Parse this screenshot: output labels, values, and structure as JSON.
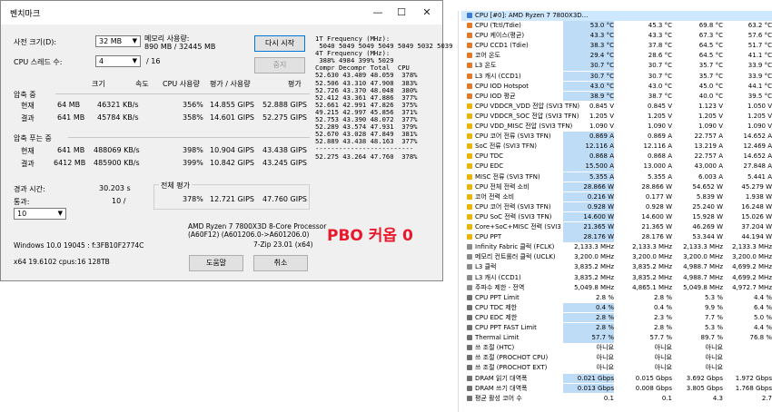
{
  "bench": {
    "title": "벤치마크",
    "dict_size_label": "사전 크기(D):",
    "dict_size_value": "32 MB",
    "threads_label": "CPU 스레드 수:",
    "threads_value": "4",
    "threads_max": "/ 16",
    "mem_usage_label": "메모리 사용량:",
    "mem_usage_value": "890 MB / 32445 MB",
    "restart_button": "다시 시작",
    "stop_button": "중지",
    "freq_text": "1T Frequency (MHz):\n 5040 5049 5049 5049 5049 5032 5039\n4T Frequency (MHz):\n 388% 4984 399% 5029\nCompr Decompr Total  CPU\n52.630 43.489 48.059  378%\n52.506 43.310 47.908  383%\n52.726 43.370 48.048  380%\n52.412 43.361 47.886  377%\n52.661 42.991 47.826  375%\n49.215 42.997 45.856  371%\n52.753 43.390 48.072  377%\n52.289 43.574 47.931  379%\n52.670 43.028 47.849  381%\n52.889 43.438 48.163  377%\n-------------------------\n52.275 43.264 47.760  378%",
    "col_headers": [
      "크기",
      "속도",
      "CPU 사용량",
      "평가 / 사용량",
      "평가"
    ],
    "compress_label": "압축 중",
    "decompress_label": "압축 푸는 중",
    "compress_rows": [
      {
        "label": "현재",
        "size": "64 MB",
        "speed": "46321 KB/s",
        "cpu": "356%",
        "per": "14.855 GIPS",
        "rating": "52.888 GIPS"
      },
      {
        "label": "결과",
        "size": "641 MB",
        "speed": "45784 KB/s",
        "cpu": "358%",
        "per": "14.601 GIPS",
        "rating": "52.275 GIPS"
      }
    ],
    "decompress_rows": [
      {
        "label": "현재",
        "size": "641 MB",
        "speed": "488069 KB/s",
        "cpu": "398%",
        "per": "10.904 GIPS",
        "rating": "43.438 GIPS"
      },
      {
        "label": "결과",
        "size": "6412 MB",
        "speed": "485900 KB/s",
        "cpu": "399%",
        "per": "10.842 GIPS",
        "rating": "43.245 GIPS"
      }
    ],
    "elapsed_label": "경과 시간:",
    "elapsed_value": "30.203 s",
    "passes_label": "통과:",
    "passes_value": "10 /",
    "passes_select": "10",
    "total_label": "전체 평가",
    "total_cpu": "378%",
    "total_per": "12.721 GIPS",
    "total_rating": "47.760 GIPS",
    "cpu_name": "AMD Ryzen 7 7800X3D 8-Core Processor",
    "cpu_id": "(A60F12) (A601206.0->A601206.0)",
    "zip_version": "7-Zip 23.01 (x64)",
    "os_info": "Windows 10.0 19045 : f:3FB10F2774C",
    "sys_info": "x64 19.6102 cpus:16 128TB",
    "help_button": "도움말",
    "cancel_button": "취소",
    "annotation": "PBO 커옵 0"
  },
  "sensor": {
    "header_label": "CPU [#0]: AMD Ryzen 7 7800X3D...",
    "rows": [
      {
        "name": "CPU (Tctl/Tdie)",
        "icon": "thermometer",
        "c": "53.0 °C",
        "min": "45.3 °C",
        "max": "69.8 °C",
        "avg": "63.2 °C",
        "hi": 0
      },
      {
        "name": "CPU 케이스(평균)",
        "icon": "thermometer",
        "c": "43.3 °C",
        "min": "43.3 °C",
        "max": "67.3 °C",
        "avg": "57.6 °C",
        "hi": 0
      },
      {
        "name": "CPU CCD1 (Tdie)",
        "icon": "thermometer",
        "c": "38.3 °C",
        "min": "37.8 °C",
        "max": "64.5 °C",
        "avg": "51.7 °C",
        "hi": 0
      },
      {
        "name": "코어 온도",
        "icon": "thermometer",
        "c": "29.4 °C",
        "min": "28.6 °C",
        "max": "64.5 °C",
        "avg": "41.1 °C",
        "hi": 0
      },
      {
        "name": "L3 온도",
        "icon": "thermometer",
        "c": "30.7 °C",
        "min": "30.7 °C",
        "max": "35.7 °C",
        "avg": "33.9 °C",
        "hi": 0
      },
      {
        "name": "L3 캐시 (CCD1)",
        "icon": "thermometer",
        "c": "30.7 °C",
        "min": "30.7 °C",
        "max": "35.7 °C",
        "avg": "33.9 °C",
        "hi": 0
      },
      {
        "name": "CPU IOD Hotspot",
        "icon": "thermometer",
        "c": "43.0 °C",
        "min": "43.0 °C",
        "max": "45.0 °C",
        "avg": "44.1 °C",
        "hi": 0
      },
      {
        "name": "CPU IOD 평균",
        "icon": "thermometer",
        "c": "38.9 °C",
        "min": "38.7 °C",
        "max": "40.0 °C",
        "avg": "39.5 °C",
        "hi": 0
      },
      {
        "name": "CPU VDDCR_VDD 전압 (SVI3 TFN)",
        "icon": "bolt",
        "c": "0.845 V",
        "min": "0.845 V",
        "max": "1.123 V",
        "avg": "1.050 V",
        "hi": 0
      },
      {
        "name": "CPU VDDCR_SOC 전압 (SVI3 TFN)",
        "icon": "bolt",
        "c": "1.205 V",
        "min": "1.205 V",
        "max": "1.205 V",
        "avg": "1.205 V",
        "hi": 0
      },
      {
        "name": "CPU VDD_MISC 전압 (SVI3 TFN)",
        "icon": "bolt",
        "c": "1.090 V",
        "min": "1.090 V",
        "max": "1.090 V",
        "avg": "1.090 V",
        "hi": 0
      },
      {
        "name": "CPU 코어 전류 (SVI3 TFN)",
        "icon": "bolt",
        "c": "0.869 A",
        "min": "0.869 A",
        "max": "22.757 A",
        "avg": "14.652 A",
        "hi": 0
      },
      {
        "name": "SoC 전류 (SVI3 TFN)",
        "icon": "bolt",
        "c": "12.116 A",
        "min": "12.116 A",
        "max": "13.219 A",
        "avg": "12.469 A",
        "hi": 0
      },
      {
        "name": "CPU TDC",
        "icon": "bolt",
        "c": "0.868 A",
        "min": "0.868 A",
        "max": "22.757 A",
        "avg": "14.652 A",
        "hi": 0
      },
      {
        "name": "CPU EDC",
        "icon": "bolt",
        "c": "15.500 A",
        "min": "13.000 A",
        "max": "43.000 A",
        "avg": "27.848 A",
        "hi": 0
      },
      {
        "name": "MISC 전류 (SVI3 TFN)",
        "icon": "bolt",
        "c": "5.355 A",
        "min": "5.355 A",
        "max": "6.003 A",
        "avg": "5.441 A",
        "hi": 0
      },
      {
        "name": "CPU 전체 전력 소비",
        "icon": "bolt",
        "c": "28.866 W",
        "min": "28.866 W",
        "max": "54.652 W",
        "avg": "45.279 W",
        "hi": 0
      },
      {
        "name": "코어 전력 소비",
        "icon": "bolt",
        "c": "0.216 W",
        "min": "0.177 W",
        "max": "5.839 W",
        "avg": "1.938 W",
        "hi": 0
      },
      {
        "name": "CPU 코어 전력 (SVI3 TFN)",
        "icon": "bolt",
        "c": "0.928 W",
        "min": "0.928 W",
        "max": "25.240 W",
        "avg": "16.248 W",
        "hi": 0
      },
      {
        "name": "CPU SoC 전력 (SVI3 TFN)",
        "icon": "bolt",
        "c": "14.600 W",
        "min": "14.600 W",
        "max": "15.928 W",
        "avg": "15.026 W",
        "hi": 0
      },
      {
        "name": "Core+SoC+MISC 전력 (SVI3 TFN)",
        "icon": "bolt",
        "c": "21.365 W",
        "min": "21.365 W",
        "max": "46.269 W",
        "avg": "37.204 W",
        "hi": 0
      },
      {
        "name": "CPU PPT",
        "icon": "bolt",
        "c": "28.176 W",
        "min": "28.176 W",
        "max": "53.344 W",
        "avg": "44.194 W",
        "hi": 0
      },
      {
        "name": "Infinity Fabric 클럭 (FCLK)",
        "icon": "clock",
        "c": "2,133.3 MHz",
        "min": "2,133.3 MHz",
        "max": "2,133.3 MHz",
        "avg": "2,133.3 MHz",
        "hi": 0
      },
      {
        "name": "메모리 컨트롤러 클럭 (UCLK)",
        "icon": "clock",
        "c": "3,200.0 MHz",
        "min": "3,200.0 MHz",
        "max": "3,200.0 MHz",
        "avg": "3,200.0 MHz",
        "hi": 0
      },
      {
        "name": "L3 클럭",
        "icon": "clock",
        "c": "3,835.2 MHz",
        "min": "3,835.2 MHz",
        "max": "4,988.7 MHz",
        "avg": "4,699.2 MHz",
        "hi": 0
      },
      {
        "name": "L3 캐시 (CCD1)",
        "icon": "clock",
        "c": "3,835.2 MHz",
        "min": "3,835.2 MHz",
        "max": "4,988.7 MHz",
        "avg": "4,699.2 MHz",
        "hi": 0
      },
      {
        "name": "주파수 제한 - 전역",
        "icon": "clock",
        "c": "5,049.8 MHz",
        "min": "4,865.1 MHz",
        "max": "5,049.8 MHz",
        "avg": "4,972.7 MHz",
        "hi": 0
      },
      {
        "name": "CPU PPT Limit",
        "icon": "gauge",
        "c": "2.8 %",
        "min": "2.8 %",
        "max": "5.3 %",
        "avg": "4.4 %",
        "hi": 0
      },
      {
        "name": "CPU TDC 제한",
        "icon": "gauge",
        "c": "0.4 %",
        "min": "0.4 %",
        "max": "9.9 %",
        "avg": "6.4 %",
        "hi": 0
      },
      {
        "name": "CPU EDC 제한",
        "icon": "gauge",
        "c": "2.8 %",
        "min": "2.3 %",
        "max": "7.7 %",
        "avg": "5.0 %",
        "hi": 0
      },
      {
        "name": "CPU PPT FAST Limit",
        "icon": "gauge",
        "c": "2.8 %",
        "min": "2.8 %",
        "max": "5.3 %",
        "avg": "4.4 %",
        "hi": 0
      },
      {
        "name": "Thermal Limit",
        "icon": "gauge",
        "c": "57.7 %",
        "min": "57.7 %",
        "max": "89.7 %",
        "avg": "76.8 %",
        "hi": 0
      },
      {
        "name": "쓰 조절 (HTC)",
        "icon": "gauge",
        "c": "아니요",
        "min": "아니요",
        "max": "아니요",
        "avg": "",
        "hi": 0
      },
      {
        "name": "쓰 조절 (PROCHOT CPU)",
        "icon": "gauge",
        "c": "아니요",
        "min": "아니요",
        "max": "아니요",
        "avg": "",
        "hi": 0
      },
      {
        "name": "쓰 조절 (PROCHOT EXT)",
        "icon": "gauge",
        "c": "아니요",
        "min": "아니요",
        "max": "아니요",
        "avg": "",
        "hi": 0
      },
      {
        "name": "DRAM 읽기 대역폭",
        "icon": "gauge",
        "c": "0.021 Gbps",
        "min": "0.015 Gbps",
        "max": "3.692 Gbps",
        "avg": "1.972 Gbps",
        "hi": 0
      },
      {
        "name": "DRAM 쓰기 대역폭",
        "icon": "gauge",
        "c": "0.013 Gbps",
        "min": "0.008 Gbps",
        "max": "3.805 Gbps",
        "avg": "1.768 Gbps",
        "hi": 0
      },
      {
        "name": "평균 활성 코어 수",
        "icon": "gauge",
        "c": "0.1",
        "min": "0.1",
        "max": "4.3",
        "avg": "2.7",
        "hi": 0
      }
    ]
  },
  "colors": {
    "highlight": "#bfdcf6",
    "header_highlight": "#cde8ff",
    "annotation": "#e8192c"
  }
}
